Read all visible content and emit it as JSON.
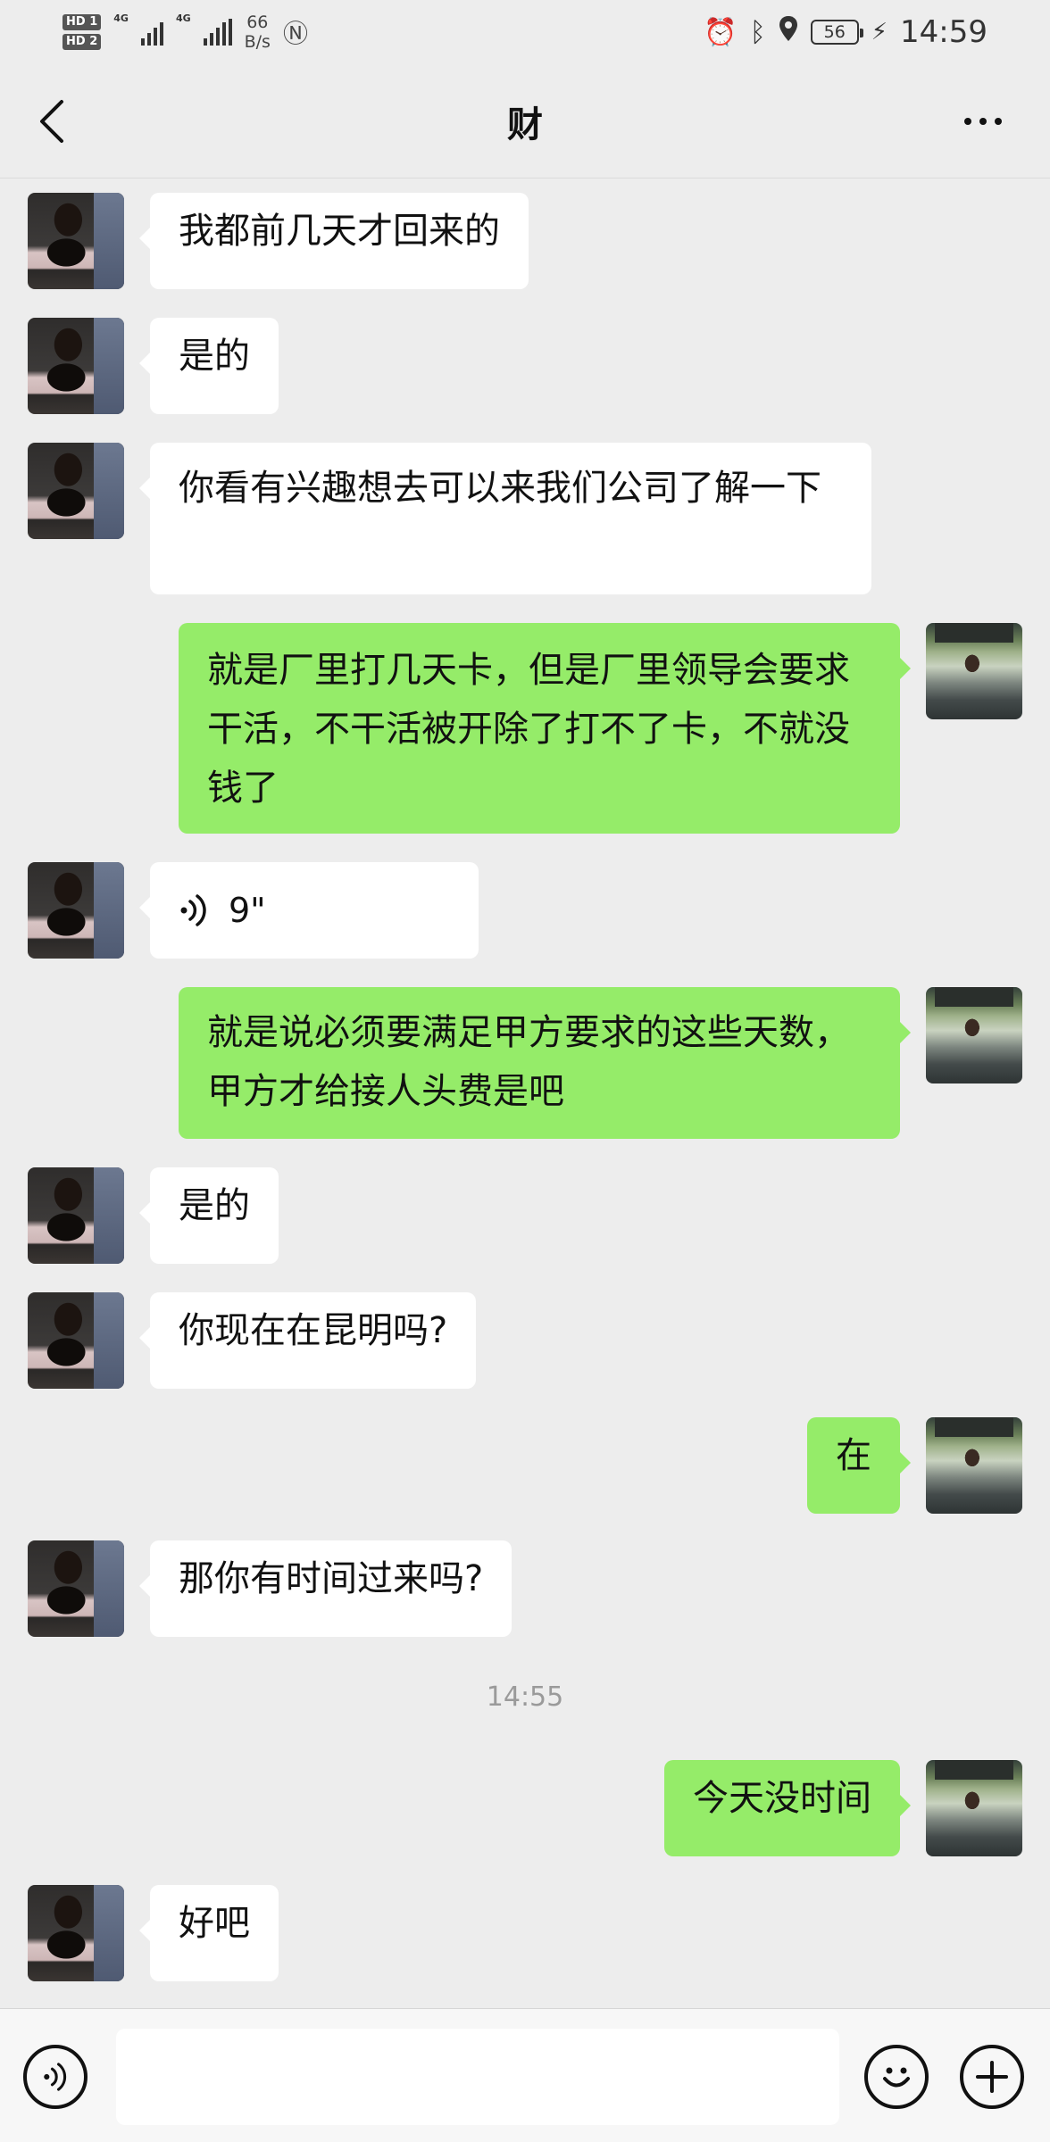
{
  "status_bar": {
    "hd1": "HD 1",
    "hd2": "HD 2",
    "network1": "4G",
    "network2": "4G",
    "speed_value": "66",
    "speed_unit": "B/s",
    "battery": "56",
    "time": "14:59",
    "icons": [
      "alarm-icon",
      "bluetooth-icon",
      "location-icon",
      "nfc-icon",
      "charging-icon"
    ]
  },
  "nav": {
    "title": "财"
  },
  "messages": [
    {
      "side": "in",
      "text": "我都前几天才回来的"
    },
    {
      "side": "in",
      "text": "是的"
    },
    {
      "side": "in",
      "text": "你看有兴趣想去可以来我们公司了解一下"
    },
    {
      "side": "out",
      "text": "就是厂里打几天卡，但是厂里领导会要求干活，不干活被开除了打不了卡，不就没钱了"
    },
    {
      "side": "in",
      "type": "voice",
      "duration": "9\""
    },
    {
      "side": "out",
      "text": "就是说必须要满足甲方要求的这些天数，甲方才给接人头费是吧"
    },
    {
      "side": "in",
      "text": "是的"
    },
    {
      "side": "in",
      "text": "你现在在昆明吗?"
    },
    {
      "side": "out",
      "text": "在"
    },
    {
      "side": "in",
      "text": "那你有时间过来吗?"
    },
    {
      "type": "timestamp",
      "text": "14:55"
    },
    {
      "side": "out",
      "text": "今天没时间"
    },
    {
      "side": "in",
      "text": "好吧"
    }
  ],
  "input_bar": {
    "placeholder": ""
  },
  "colors": {
    "background": "#ededed",
    "incoming_bubble": "#ffffff",
    "outgoing_bubble": "#95ec69"
  }
}
